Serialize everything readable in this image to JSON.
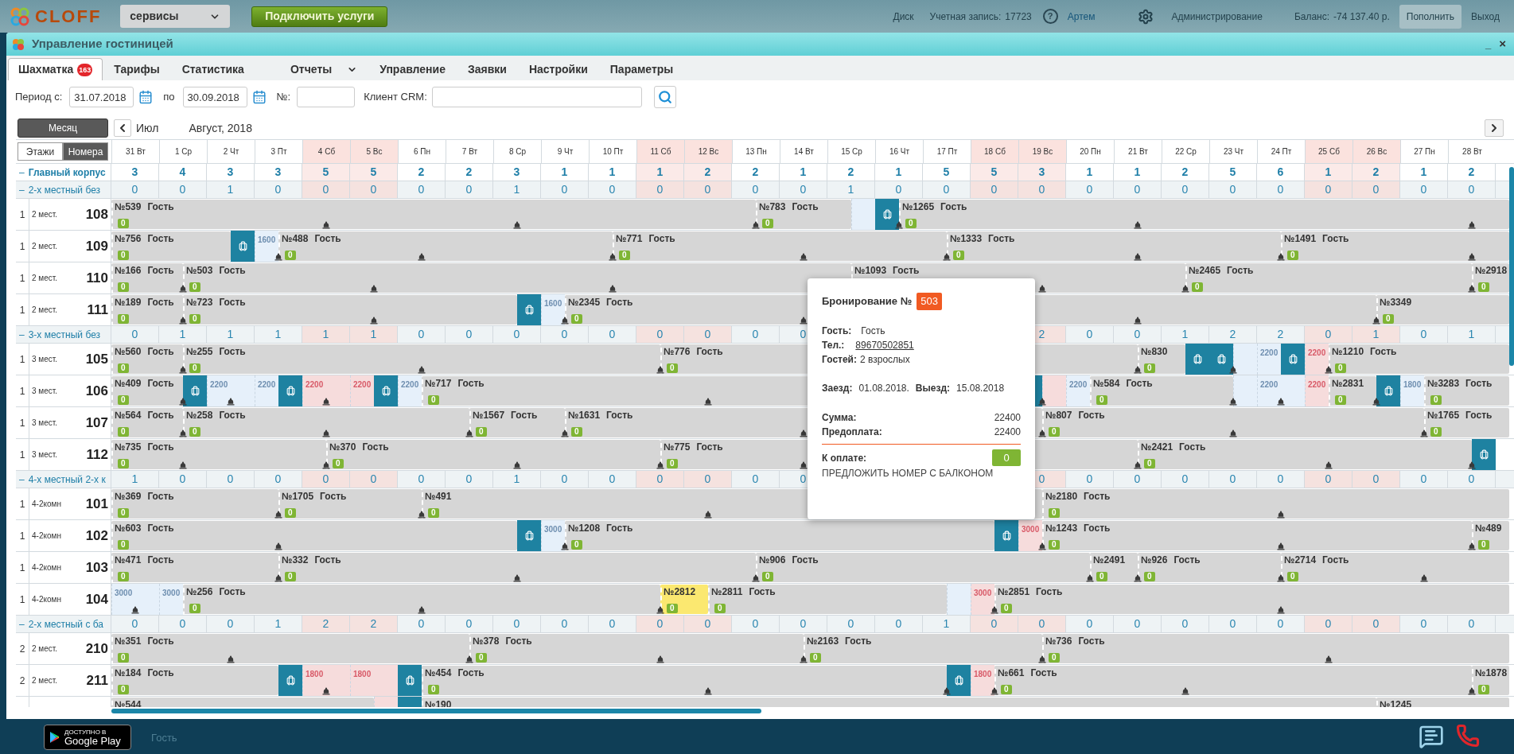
{
  "topbar": {
    "logo_text": "CLOFF",
    "services_dropdown": "сервисы",
    "connect_button": "Подключить услуги",
    "disk": "Диск",
    "account_label": "Учетная запись:",
    "account_number": "17723",
    "help": "?",
    "user": "Артем",
    "admin": "Администрирование",
    "balance_label": "Баланс:",
    "balance": "-74 137.40 р.",
    "topup_button": "Пополнить",
    "logout": "Выход"
  },
  "window": {
    "title": "Управление гостиницей",
    "minimize": "_",
    "close": "×"
  },
  "tabs": [
    {
      "label": "Шахматка",
      "selected": true,
      "badge": "163",
      "menu": false
    },
    {
      "label": "Тарифы",
      "selected": false,
      "menu": false
    },
    {
      "label": "Статистика",
      "selected": false,
      "menu": false
    },
    {
      "label": "Отчеты",
      "selected": false,
      "menu": true
    },
    {
      "label": "Управление",
      "selected": false,
      "menu": false
    },
    {
      "label": "Заявки",
      "selected": false,
      "menu": false
    },
    {
      "label": "Настройки",
      "selected": false,
      "menu": false
    },
    {
      "label": "Параметры",
      "selected": false,
      "menu": false
    }
  ],
  "filters": {
    "period_from_label": "Период с:",
    "period_from": "31.07.2018",
    "period_to_label": "по",
    "period_to": "30.09.2018",
    "number_label": "№:",
    "client_label": "Клиент CRM:"
  },
  "grid": {
    "period_button": "Месяц",
    "view_toggle": [
      {
        "label": "Этажи",
        "selected": false
      },
      {
        "label": "Номера",
        "selected": true
      }
    ],
    "prev": "Июл",
    "month": "Август, 2018",
    "days": [
      {
        "label": "31 Вт",
        "weekend": false
      },
      {
        "label": "1 Ср",
        "weekend": false
      },
      {
        "label": "2 Чт",
        "weekend": false
      },
      {
        "label": "3 Пт",
        "weekend": false
      },
      {
        "label": "4 Сб",
        "weekend": true
      },
      {
        "label": "5 Вс",
        "weekend": true
      },
      {
        "label": "6 Пн",
        "weekend": false
      },
      {
        "label": "7 Вт",
        "weekend": false
      },
      {
        "label": "8 Ср",
        "weekend": false
      },
      {
        "label": "9 Чт",
        "weekend": false
      },
      {
        "label": "10 Пт",
        "weekend": false
      },
      {
        "label": "11 Сб",
        "weekend": true
      },
      {
        "label": "12 Вс",
        "weekend": true
      },
      {
        "label": "13 Пн",
        "weekend": false
      },
      {
        "label": "14 Вт",
        "weekend": false
      },
      {
        "label": "15 Ср",
        "weekend": false
      },
      {
        "label": "16 Чт",
        "weekend": false
      },
      {
        "label": "17 Пт",
        "weekend": false
      },
      {
        "label": "18 Сб",
        "weekend": true
      },
      {
        "label": "19 Вс",
        "weekend": true
      },
      {
        "label": "20 Пн",
        "weekend": false
      },
      {
        "label": "21 Вт",
        "weekend": false
      },
      {
        "label": "22 Ср",
        "weekend": false
      },
      {
        "label": "23 Чт",
        "weekend": false
      },
      {
        "label": "24 Пт",
        "weekend": false
      },
      {
        "label": "25 Сб",
        "weekend": true
      },
      {
        "label": "26 Вс",
        "weekend": true
      },
      {
        "label": "27 Пн",
        "weekend": false
      },
      {
        "label": "28 Вт",
        "weekend": false
      }
    ],
    "building": {
      "toggle": "–",
      "name": "Главный корпус",
      "counts": [
        "3",
        "4",
        "3",
        "3",
        "5",
        "5",
        "2",
        "2",
        "3",
        "1",
        "1",
        "1",
        "2",
        "2",
        "1",
        "2",
        "1",
        "5",
        "5",
        "3",
        "1",
        "1",
        "2",
        "5",
        "6",
        "1",
        "2",
        "1",
        "2"
      ]
    },
    "sections": [
      {
        "toggle": "–",
        "name": "2-х местный без",
        "counts": [
          "0",
          "0",
          "1",
          "0",
          "0",
          "0",
          "0",
          "0",
          "1",
          "0",
          "0",
          "0",
          "0",
          "0",
          "0",
          "1",
          "0",
          "0",
          "0",
          "0",
          "0",
          "0",
          "0",
          "0",
          "0",
          "0",
          "0",
          "0",
          "0"
        ],
        "rooms": [
          {
            "floor": "1",
            "type": "2 мест.",
            "number": "108",
            "segments": [
              {
                "kind": "booking",
                "number": "№539",
                "guest": "Гость",
                "badge": "0"
              },
              {
                "kind": "booking",
                "number": "№783",
                "guest": "Гость",
                "badge": "0"
              },
              {
                "kind": "free"
              },
              {
                "kind": "luggage"
              },
              {
                "kind": "booking",
                "number": "№1265",
                "guest": "Гость",
                "badge": "0"
              }
            ]
          },
          {
            "floor": "1",
            "type": "2 мест.",
            "number": "109",
            "segments": [
              {
                "kind": "booking",
                "number": "№756",
                "guest": "Гость",
                "badge": "0"
              },
              {
                "kind": "luggage"
              },
              {
                "kind": "free",
                "price": "1600"
              },
              {
                "kind": "booking",
                "number": "№488",
                "guest": "Гость",
                "badge": "0"
              },
              {
                "kind": "booking",
                "number": "№771",
                "guest": "Гость",
                "badge": "0"
              },
              {
                "kind": "booking",
                "number": "№1333",
                "guest": "Гость",
                "badge": "0"
              },
              {
                "kind": "booking",
                "number": "№1491",
                "guest": "Гость",
                "badge": "0"
              }
            ]
          },
          {
            "floor": "1",
            "type": "2 мест.",
            "number": "110",
            "segments": [
              {
                "kind": "booking",
                "number": "№166",
                "guest": "Гость",
                "badge": "0"
              },
              {
                "kind": "booking",
                "number": "№503",
                "guest": "Гость",
                "badge": "0"
              },
              {
                "kind": "booking",
                "number": "№1093",
                "guest": "Гость"
              },
              {
                "kind": "booking",
                "number": "№2465",
                "guest": "Гость",
                "badge": "0"
              },
              {
                "kind": "booking",
                "number": "№2918",
                "badge": "0"
              }
            ]
          },
          {
            "floor": "1",
            "type": "2 мест.",
            "number": "111",
            "segments": [
              {
                "kind": "booking",
                "number": "№189",
                "guest": "Гость",
                "badge": "0"
              },
              {
                "kind": "booking",
                "number": "№723",
                "guest": "Гость",
                "badge": "0"
              },
              {
                "kind": "luggage"
              },
              {
                "kind": "free",
                "price": "1600"
              },
              {
                "kind": "booking",
                "number": "№2345",
                "guest": "Гость",
                "badge": "0"
              },
              {
                "kind": "booking",
                "number": "№3349",
                "badge": "0"
              }
            ]
          }
        ]
      },
      {
        "toggle": "–",
        "name": "3-х местный без",
        "counts": [
          "0",
          "1",
          "1",
          "1",
          "1",
          "1",
          "0",
          "0",
          "0",
          "0",
          "0",
          "0",
          "0",
          "0",
          "0",
          "2",
          "0",
          "0",
          "1",
          "2",
          "2",
          "0",
          "1",
          "0",
          "1"
        ],
        "rooms": [
          {
            "floor": "1",
            "type": "3 мест.",
            "number": "105",
            "segments": [
              {
                "kind": "booking",
                "number": "№560",
                "guest": "Гость",
                "badge": "0"
              },
              {
                "kind": "booking",
                "number": "№255",
                "guest": "Гость",
                "badge": "0"
              },
              {
                "kind": "booking",
                "number": "№776",
                "guest": "Гость",
                "badge": "0"
              },
              {
                "kind": "booking",
                "number": "№830",
                "badge": "0"
              },
              {
                "kind": "luggage"
              },
              {
                "kind": "luggage"
              },
              {
                "kind": "free"
              },
              {
                "kind": "free",
                "price": "2200"
              },
              {
                "kind": "luggage"
              },
              {
                "kind": "free",
                "price": "2200"
              },
              {
                "kind": "booking",
                "number": "№1210",
                "guest": "Гость",
                "badge": "0"
              }
            ]
          },
          {
            "floor": "1",
            "type": "3 мест.",
            "number": "106",
            "segments": [
              {
                "kind": "booking",
                "number": "№409",
                "guest": "Гость",
                "badge": "0"
              },
              {
                "kind": "luggage"
              },
              {
                "kind": "free",
                "price": "2200"
              },
              {
                "kind": "free",
                "price": "2200"
              },
              {
                "kind": "luggage"
              },
              {
                "kind": "free",
                "price": "2200"
              },
              {
                "kind": "free",
                "price": "2200"
              },
              {
                "kind": "luggage"
              },
              {
                "kind": "free",
                "price": "2200"
              },
              {
                "kind": "booking",
                "number": "№717",
                "guest": "Гость",
                "badge": "0"
              },
              {
                "kind": "blocked"
              },
              {
                "kind": "free"
              },
              {
                "kind": "free",
                "price": "2200"
              },
              {
                "kind": "booking",
                "number": "№584",
                "guest": "Гость",
                "badge": "0"
              },
              {
                "kind": "free"
              },
              {
                "kind": "free",
                "price": "2200"
              },
              {
                "kind": "free",
                "price": "2200"
              },
              {
                "kind": "booking",
                "number": "№2831",
                "badge": "0"
              },
              {
                "kind": "luggage"
              },
              {
                "kind": "free",
                "price": "1800"
              },
              {
                "kind": "booking",
                "number": "№3283",
                "guest": "Гость",
                "badge": "0"
              }
            ]
          },
          {
            "floor": "1",
            "type": "3 мест.",
            "number": "107",
            "segments": [
              {
                "kind": "booking",
                "number": "№564",
                "guest": "Гость",
                "badge": "0"
              },
              {
                "kind": "booking",
                "number": "№258",
                "guest": "Гость",
                "badge": "0"
              },
              {
                "kind": "booking",
                "number": "№1567",
                "guest": "Гость",
                "badge": "0"
              },
              {
                "kind": "booking",
                "number": "№1631",
                "guest": "Гость",
                "badge": "0"
              },
              {
                "kind": "booking",
                "number": "№807",
                "guest": "Гость",
                "badge": "0"
              },
              {
                "kind": "booking",
                "number": "№1765",
                "guest": "Гость",
                "badge": "0"
              }
            ]
          },
          {
            "floor": "1",
            "type": "3 мест.",
            "number": "112",
            "segments": [
              {
                "kind": "booking",
                "number": "№735",
                "guest": "Гость",
                "badge": "0"
              },
              {
                "kind": "booking",
                "number": "№370",
                "guest": "Гость",
                "badge": "0"
              },
              {
                "kind": "booking",
                "number": "№775",
                "guest": "Гость",
                "badge": "0"
              },
              {
                "kind": "booking",
                "number": "№2421",
                "guest": "Гость",
                "badge": "0"
              },
              {
                "kind": "luggage"
              }
            ]
          }
        ]
      },
      {
        "toggle": "–",
        "name": "4-х местный 2-х к",
        "counts": [
          "1",
          "0",
          "0",
          "0",
          "0",
          "0",
          "0",
          "0",
          "1",
          "0",
          "0",
          "0",
          "0",
          "0",
          "0",
          "0",
          "0",
          "0",
          "0",
          "0",
          "0",
          "0",
          "0",
          "0",
          "0"
        ],
        "rooms": [
          {
            "floor": "1",
            "type": "4-2комн",
            "number": "101",
            "segments": [
              {
                "kind": "booking",
                "number": "№369",
                "guest": "Гость",
                "badge": "0"
              },
              {
                "kind": "booking",
                "number": "№1705",
                "guest": "Гость",
                "badge": "0"
              },
              {
                "kind": "booking",
                "number": "№491",
                "badge": "0"
              },
              {
                "kind": "booking",
                "number": "№2180",
                "guest": "Гость",
                "badge": "0"
              }
            ]
          },
          {
            "floor": "1",
            "type": "4-2комн",
            "number": "102",
            "segments": [
              {
                "kind": "booking",
                "number": "№603",
                "guest": "Гость",
                "badge": "0"
              },
              {
                "kind": "luggage"
              },
              {
                "kind": "free",
                "price": "3000"
              },
              {
                "kind": "booking",
                "number": "№1208",
                "guest": "Гость",
                "badge": "0"
              },
              {
                "kind": "luggage"
              },
              {
                "kind": "free",
                "price": "3000"
              },
              {
                "kind": "booking",
                "number": "№1243",
                "guest": "Гость",
                "badge": "0"
              },
              {
                "kind": "booking",
                "number": "№489",
                "badge": "0"
              }
            ]
          },
          {
            "floor": "1",
            "type": "4-2комн",
            "number": "103",
            "segments": [
              {
                "kind": "booking",
                "number": "№471",
                "guest": "Гость",
                "badge": "0"
              },
              {
                "kind": "booking",
                "number": "№332",
                "guest": "Гость",
                "badge": "0"
              },
              {
                "kind": "booking",
                "number": "№906",
                "guest": "Гость",
                "badge": "0"
              },
              {
                "kind": "booking",
                "number": "№2491",
                "badge": "0"
              },
              {
                "kind": "booking",
                "number": "№926",
                "guest": "Гость",
                "badge": "0"
              },
              {
                "kind": "booking",
                "number": "№2714",
                "guest": "Гость",
                "badge": "0"
              }
            ]
          },
          {
            "floor": "1",
            "type": "4-2комн",
            "number": "104",
            "segments": [
              {
                "kind": "free",
                "price": "3000"
              },
              {
                "kind": "free",
                "price": "3000"
              },
              {
                "kind": "booking",
                "number": "№256",
                "guest": "Гость",
                "badge": "0"
              },
              {
                "kind": "pending",
                "number": "№2812",
                "badge": "0"
              },
              {
                "kind": "booking",
                "number": "№2811",
                "guest": "Гость",
                "badge": "0"
              },
              {
                "kind": "free"
              },
              {
                "kind": "free",
                "price": "3000"
              },
              {
                "kind": "booking",
                "number": "№2851",
                "guest": "Гость",
                "badge": "0"
              }
            ]
          }
        ]
      },
      {
        "toggle": "–",
        "name": "2-х местный с ба",
        "counts": [
          "0",
          "0",
          "0",
          "1",
          "2",
          "2",
          "0",
          "0",
          "0",
          "0",
          "0",
          "0",
          "0",
          "0",
          "0",
          "0",
          "0",
          "1",
          "0",
          "0",
          "0",
          "0",
          "0",
          "0",
          "0",
          "0",
          "0",
          "0",
          "0"
        ],
        "rooms": [
          {
            "floor": "2",
            "type": "2 мест.",
            "number": "210",
            "segments": [
              {
                "kind": "booking",
                "number": "№351",
                "guest": "Гость",
                "badge": "0"
              },
              {
                "kind": "booking",
                "number": "№378",
                "guest": "Гость",
                "badge": "0"
              },
              {
                "kind": "booking",
                "number": "№2163",
                "guest": "Гость",
                "badge": "0"
              },
              {
                "kind": "booking",
                "number": "№736",
                "guest": "Гость",
                "badge": "0"
              }
            ]
          },
          {
            "floor": "2",
            "type": "2 мест.",
            "number": "211",
            "segments": [
              {
                "kind": "booking",
                "number": "№184",
                "guest": "Гость",
                "badge": "0"
              },
              {
                "kind": "luggage"
              },
              {
                "kind": "free",
                "price": "1800"
              },
              {
                "kind": "free",
                "price": "1800"
              },
              {
                "kind": "luggage"
              },
              {
                "kind": "booking",
                "number": "№454",
                "guest": "Гость",
                "badge": "0"
              },
              {
                "kind": "luggage"
              },
              {
                "kind": "free",
                "price": "1800"
              },
              {
                "kind": "booking",
                "number": "№661",
                "guest": "Гость",
                "badge": "0"
              },
              {
                "kind": "booking",
                "number": "№1878",
                "badge": "0"
              }
            ]
          },
          {
            "segments": [
              {
                "kind": "booking",
                "number": "№544"
              },
              {
                "kind": "free"
              },
              {
                "kind": "blocked"
              },
              {
                "kind": "booking",
                "number": "№190"
              },
              {
                "kind": "booking",
                "number": "№1245"
              }
            ]
          }
        ]
      }
    ]
  },
  "booking_popup": {
    "title": "Бронирование №",
    "number": "503",
    "guest_label": "Гость:",
    "guest": "Гость",
    "phone_label": "Тел.:",
    "phone": "89670502851",
    "guests_label": "Гостей:",
    "guests": "2 взрослых",
    "checkin_label": "Заезд:",
    "checkin": "01.08.2018.",
    "checkout_label": "Выезд:",
    "checkout": "15.08.2018",
    "sum_label": "Сумма:",
    "sum": "22400",
    "prepaid_label": "Предоплата:",
    "prepaid": "22400",
    "due_label": "К оплате:",
    "due": "0",
    "note": "ПРЕДЛОЖИТЬ НОМЕР С БАЛКОНОМ"
  },
  "footer": {
    "store_small": "ДОСТУПНО В",
    "store_name": "Google Play",
    "faint_text": "Гость"
  }
}
